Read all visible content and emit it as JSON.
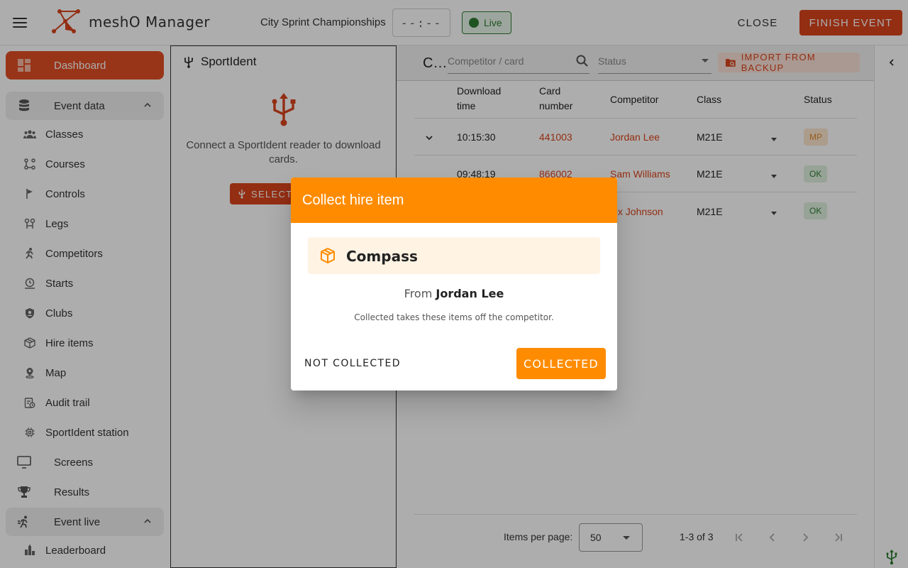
{
  "app": {
    "title": "meshO Manager",
    "event_name": "City Sprint Championships",
    "clock": "--:--",
    "live_label": "Live",
    "close_label": "CLOSE",
    "finish_label": "FINISH EVENT",
    "colors": {
      "accent": "#d9441c",
      "dialog": "#ff8c00",
      "live": "#2e7d32"
    }
  },
  "sidebar": {
    "dashboard": {
      "label": "Dashboard",
      "icon": "dashboard-icon"
    },
    "event_data": {
      "label": "Event data",
      "icon": "database-icon"
    },
    "event_data_items": [
      {
        "label": "Classes",
        "icon": "groups-icon"
      },
      {
        "label": "Courses",
        "icon": "route-icon"
      },
      {
        "label": "Controls",
        "icon": "flag-icon"
      },
      {
        "label": "Legs",
        "icon": "legs-icon"
      },
      {
        "label": "Competitors",
        "icon": "runner-icon"
      },
      {
        "label": "Starts",
        "icon": "timer-icon"
      },
      {
        "label": "Clubs",
        "icon": "shield-icon"
      },
      {
        "label": "Hire items",
        "icon": "package-icon"
      },
      {
        "label": "Map",
        "icon": "map-pin-icon"
      },
      {
        "label": "Audit trail",
        "icon": "audit-icon"
      },
      {
        "label": "SportIdent station",
        "icon": "chip-icon"
      }
    ],
    "screens": {
      "label": "Screens",
      "icon": "monitor-icon"
    },
    "results": {
      "label": "Results",
      "icon": "trophy-icon"
    },
    "event_live": {
      "label": "Event live",
      "icon": "running-icon"
    },
    "event_live_items": [
      {
        "label": "Leaderboard",
        "icon": "leaderboard-icon"
      }
    ]
  },
  "sportident": {
    "title": "SportIdent",
    "message": "Connect a SportIdent reader to download cards.",
    "select_label": "SELECT"
  },
  "main": {
    "title": "C…",
    "search_placeholder": "Competitor / card",
    "status_placeholder": "Status",
    "import_label": "IMPORT FROM BACKUP",
    "columns": {
      "download_time": [
        "Download",
        "time"
      ],
      "card_number": [
        "Card",
        "number"
      ],
      "competitor": "Competitor",
      "class": "Class",
      "status": "Status"
    },
    "rows": [
      {
        "time": "10:15:30",
        "card": "441003",
        "competitor": "Jordan Lee",
        "class": "M21E",
        "status": "MP"
      },
      {
        "time": "09:48:19",
        "card": "866002",
        "competitor": "Sam Williams",
        "class": "M21E",
        "status": "OK"
      },
      {
        "time": "",
        "card": "",
        "competitor": "lex Johnson",
        "class": "M21E",
        "status": "OK"
      }
    ],
    "paginator": {
      "label": "Items per page:",
      "page_size": "50",
      "range": "1-3 of 3"
    }
  },
  "dialog": {
    "title": "Collect hire item",
    "item_name": "Compass",
    "item_icon": "package-icon",
    "from_prefix": "From",
    "from_name": "Jordan Lee",
    "note": "Collected takes these items off the competitor.",
    "not_collected_label": "NOT COLLECTED",
    "collected_label": "COLLECTED"
  }
}
